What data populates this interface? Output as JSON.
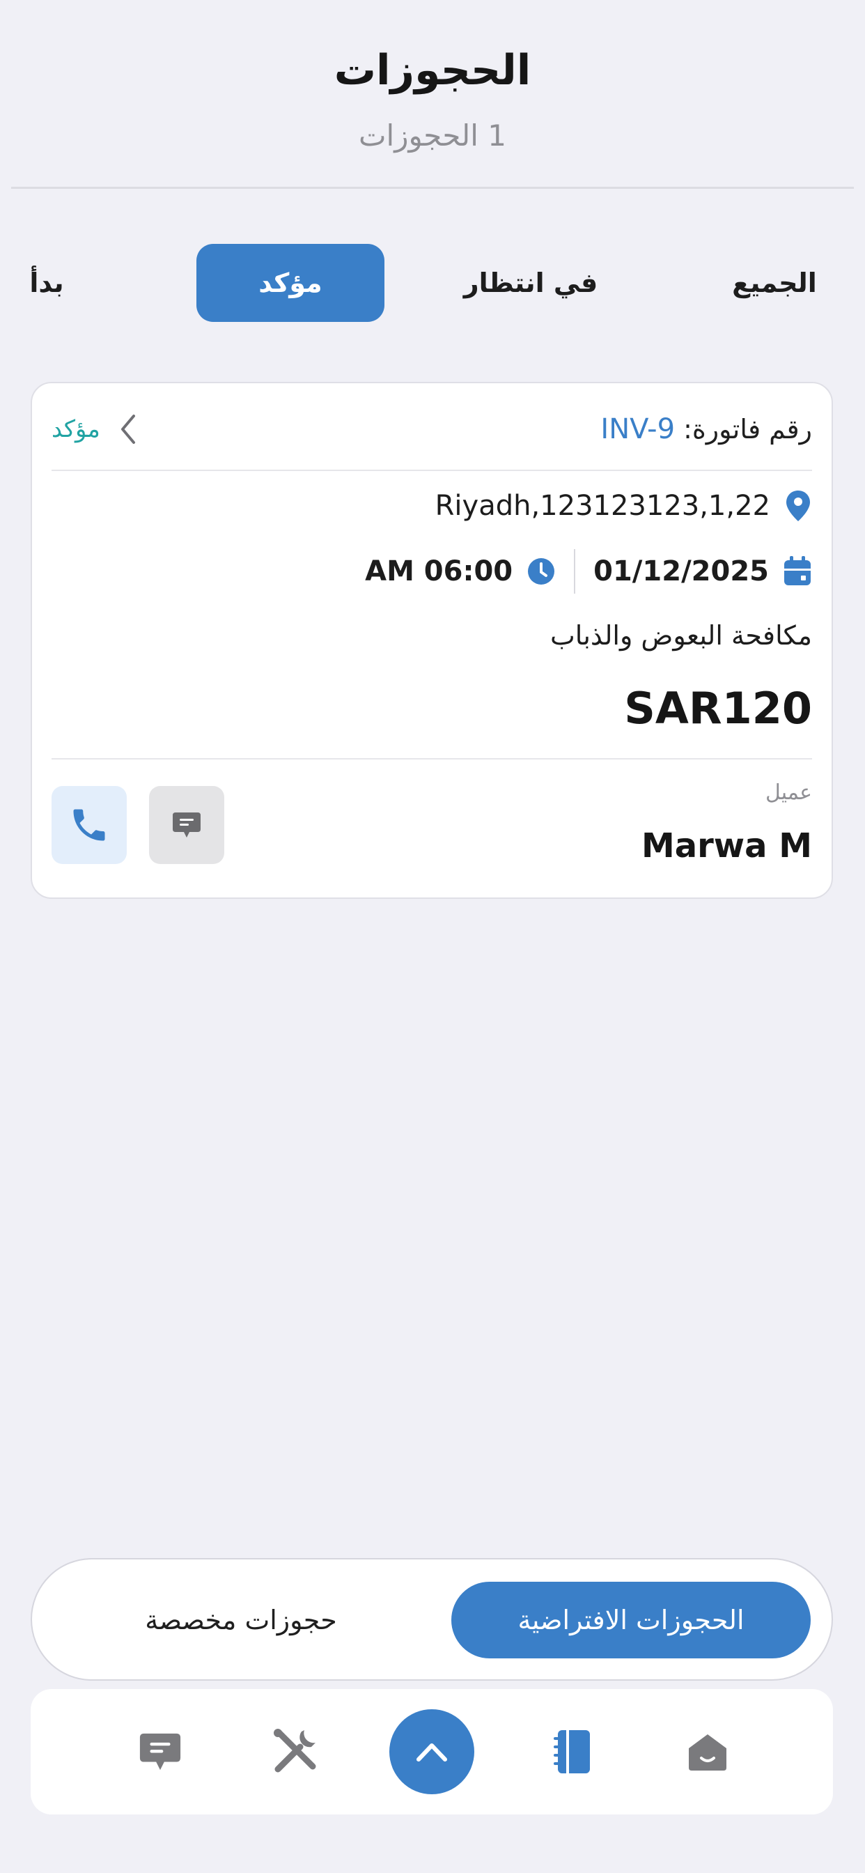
{
  "header": {
    "title": "الحجوزات",
    "subtitle": "1 الحجوزات"
  },
  "filter_tabs": [
    {
      "label": "الجميع",
      "active": false
    },
    {
      "label": "في انتظار",
      "active": false
    },
    {
      "label": "مؤكد",
      "active": true
    },
    {
      "label": "بدأ",
      "active": false
    }
  ],
  "booking": {
    "invoice_label": "رقم فاتورة: ",
    "invoice_number": "INV-9",
    "status": "مؤكد",
    "address": "Riyadh,123123123,1,22",
    "date": "01/12/2025",
    "time": "AM 06:00",
    "service": "مكافحة البعوض والذباب",
    "price": "SAR120",
    "customer_label": "عميل",
    "customer_name": "Marwa M"
  },
  "segment": {
    "default_label": "الحجوزات الافتراضية",
    "custom_label": "حجوزات مخصصة"
  },
  "bottom_nav": {
    "items": [
      "home-icon",
      "bookings-icon",
      "expand-icon",
      "tools-icon",
      "chat-icon"
    ]
  },
  "colors": {
    "accent": "#3a7fc8",
    "status": "#21a3a3",
    "background": "#f0f0f6"
  }
}
